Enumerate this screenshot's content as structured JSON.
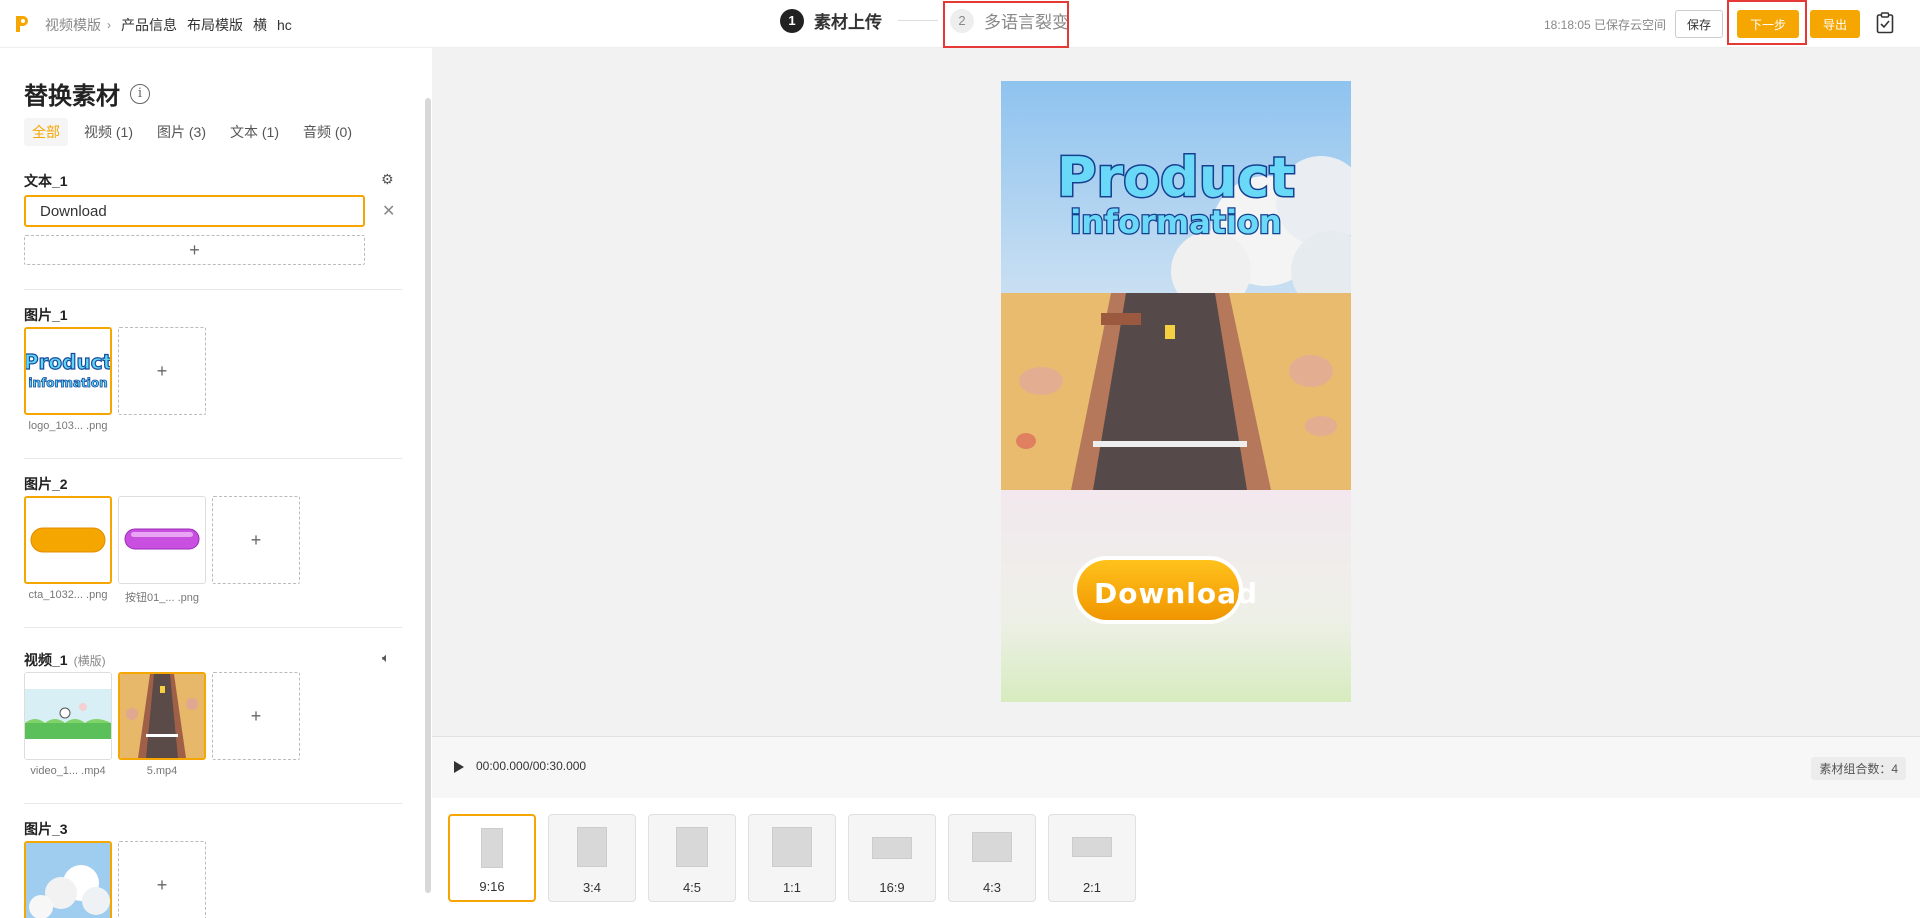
{
  "header": {
    "breadcrumb": {
      "root": "视频模版",
      "items": [
        "产品信息",
        "布局模版",
        "横",
        "hc"
      ]
    },
    "steps": [
      {
        "num": "1",
        "label": "素材上传"
      },
      {
        "num": "2",
        "label": "多语言裂变"
      }
    ],
    "save_status": "18:18:05 已保存云空间",
    "save_label": "保存",
    "next_label": "下一步",
    "export_label": "导出"
  },
  "panel": {
    "title": "替换素材",
    "filters": [
      "全部",
      "视频 (1)",
      "图片 (3)",
      "文本 (1)",
      "音频 (0)"
    ],
    "text_1": {
      "title": "文本_1",
      "value": "Download"
    },
    "image_1": {
      "title": "图片_1",
      "files": [
        "logo_103... .png"
      ]
    },
    "image_2": {
      "title": "图片_2",
      "files": [
        "cta_1032... .png",
        "按钮01_...  .png"
      ]
    },
    "video_1": {
      "title": "视频_1",
      "subtitle": "(横版)",
      "files": [
        "video_1...  .mp4",
        "5.mp4"
      ]
    },
    "image_3": {
      "title": "图片_3"
    }
  },
  "preview": {
    "logo_line1": "Product",
    "logo_line2": "information",
    "cta_text": "Download"
  },
  "timeline": {
    "time": "00:00.000/00:30.000",
    "combo": "素材组合数：4"
  },
  "ratios": [
    "9:16",
    "3:4",
    "4:5",
    "1:1",
    "16:9",
    "4:3",
    "2:1"
  ],
  "colors": {
    "accent": "#f5a600",
    "highlight": "#e53935"
  }
}
